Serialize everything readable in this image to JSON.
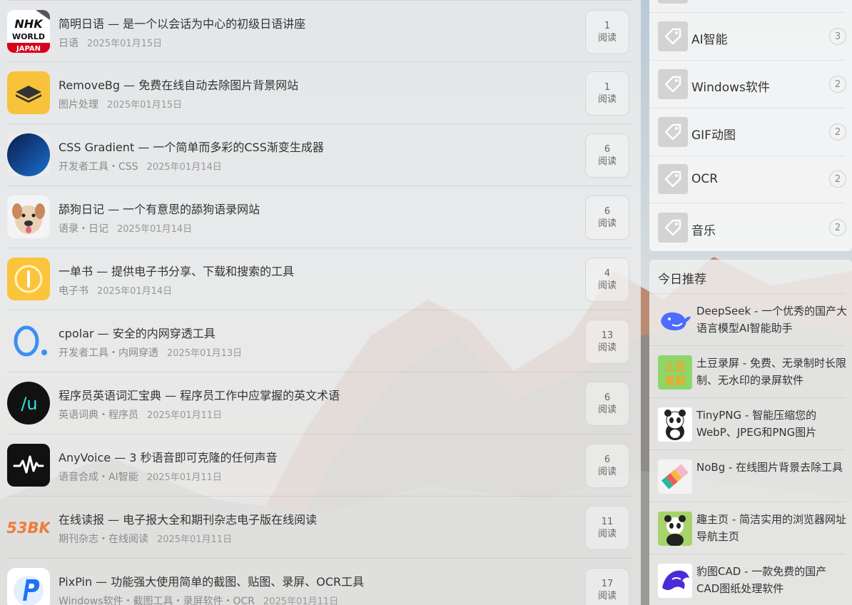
{
  "articles": [
    {
      "icon": "nhk-world-japan-icon",
      "title": "简明日语 — 是一个以会话为中心的初级日语讲座",
      "tags": "日语",
      "date": "2025年01月15日",
      "reads": "1",
      "read_label": "阅读"
    },
    {
      "icon": "removebg-icon",
      "title": "RemoveBg — 免费在线自动去除图片背景网站",
      "tags": "图片处理",
      "date": "2025年01月15日",
      "reads": "1",
      "read_label": "阅读"
    },
    {
      "icon": "css-gradient-icon",
      "title": "CSS Gradient — 一个简单而多彩的CSS渐变生成器",
      "tags": "开发者工具・CSS",
      "date": "2025年01月14日",
      "reads": "6",
      "read_label": "阅读"
    },
    {
      "icon": "dog-diary-icon",
      "title": "舔狗日记 — 一个有意思的舔狗语录网站",
      "tags": "语录・日记",
      "date": "2025年01月14日",
      "reads": "6",
      "read_label": "阅读"
    },
    {
      "icon": "yidanshu-icon",
      "title": "一单书 — 提供电子书分享、下载和搜索的工具",
      "tags": "电子书",
      "date": "2025年01月14日",
      "reads": "4",
      "read_label": "阅读"
    },
    {
      "icon": "cpolar-icon",
      "title": "cpolar — 安全的内网穿透工具",
      "tags": "开发者工具・内网穿透",
      "date": "2025年01月13日",
      "reads": "13",
      "read_label": "阅读"
    },
    {
      "icon": "programmer-vocab-icon",
      "title": "程序员英语词汇宝典 — 程序员工作中应掌握的英文术语",
      "tags": "英语词典・程序员",
      "date": "2025年01月11日",
      "reads": "6",
      "read_label": "阅读"
    },
    {
      "icon": "anyvoice-icon",
      "title": "AnyVoice — 3 秒语音即可克隆的任何声音",
      "tags": "语音合成・AI智能",
      "date": "2025年01月11日",
      "reads": "6",
      "read_label": "阅读"
    },
    {
      "icon": "53bk-icon",
      "title": "在线读报 — 电子报大全和期刊杂志电子版在线阅读",
      "tags": "期刊杂志・在线阅读",
      "date": "2025年01月11日",
      "reads": "11",
      "read_label": "阅读"
    },
    {
      "icon": "pixpin-icon",
      "title": "PixPin — 功能强大使用简单的截图、贴图、录屏、OCR工具",
      "tags": "Windows软件・截图工具・录屏软件・OCR",
      "date": "2025年01月11日",
      "reads": "17",
      "read_label": "阅读"
    }
  ],
  "tags_panel": {
    "items": [
      {
        "name": "AI智能",
        "count": "3"
      },
      {
        "name": "Windows软件",
        "count": "2"
      },
      {
        "name": "GIF动图",
        "count": "2"
      },
      {
        "name": "OCR",
        "count": "2"
      },
      {
        "name": "音乐",
        "count": "2"
      }
    ]
  },
  "recommend": {
    "heading": "今日推荐",
    "items": [
      {
        "icon": "deepseek-whale-icon",
        "text": "DeepSeek - 一个优秀的国产大语言模型AI智能助手"
      },
      {
        "icon": "tudou-recorder-icon",
        "text": "土豆录屏 - 免费、无录制时长限制、无水印的录屏软件",
        "icon_text_1": "土豆",
        "icon_text_2": "录屏"
      },
      {
        "icon": "tinypng-panda-icon",
        "text": "TinyPNG - 智能压缩您的WebP、JPEG和PNG图片"
      },
      {
        "icon": "nobg-eraser-icon",
        "text": "NoBg - 在线图片背景去除工具"
      },
      {
        "icon": "quzhuye-panda-icon",
        "text": "趣主页 - 简洁实用的浏览器网址导航主页"
      },
      {
        "icon": "baotu-cad-icon",
        "text": "豹图CAD - 一款免费的国产CAD图纸处理软件"
      }
    ]
  },
  "icon_text": {
    "nhk_line1": "NHK",
    "nhk_line2": "WORLD",
    "nhk_line3": "JAPAN",
    "bk53": "53BK",
    "programmer": "/u"
  },
  "colors": {
    "nhk_red": "#d8001b",
    "removebg_yellow": "#f8c33a",
    "yidanshu_yellow": "#fcc43a",
    "cpolar_blue": "#3a8ef6",
    "bk53_orange": "#f07a3c",
    "deepseek_blue": "#4d6bfe",
    "tudou_green": "#8dd66a"
  }
}
